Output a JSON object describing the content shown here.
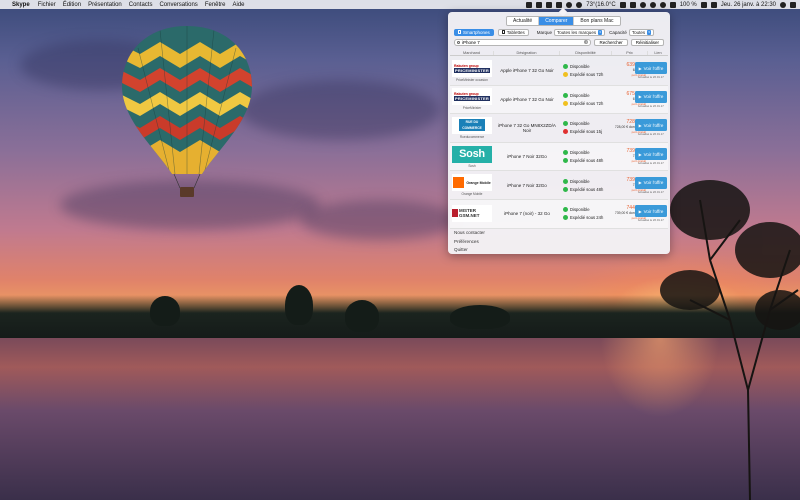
{
  "menubar": {
    "apple": "",
    "app": "Skype",
    "items": [
      "Fichier",
      "Édition",
      "Présentation",
      "Contacts",
      "Conversations",
      "Fenêtre",
      "Aide"
    ],
    "temperature": "73°(16.0°C",
    "battery": "100 %",
    "datetime": "Jeu. 26 janv. à 22:30"
  },
  "popover": {
    "tabs": [
      {
        "label": "Actualité",
        "active": false
      },
      {
        "label": "Comparer",
        "active": true
      },
      {
        "label": "Bon plans Mac",
        "active": false
      }
    ],
    "filters": {
      "smartphones": "Smartphones",
      "tablettes": "Tablettes",
      "marque_label": "Marque",
      "marque_value": "Toutes les marques",
      "capacite_label": "Capacité",
      "capacite_value": "Toutes"
    },
    "search": {
      "value": "iPhone 7",
      "rechercher": "Rechercher",
      "reinitialiser": "Réinitialiser"
    },
    "columns": [
      "Marchand",
      "Désignation",
      "Disponibilité",
      "Prix",
      "Lien"
    ],
    "rows": [
      {
        "logo": "rakuten",
        "logo_top": "Rakuten group",
        "logo_main": "PRICEMINISTER",
        "merchant": "PriceMinister occasion",
        "designation": "Apple iPhone 7 32 Go Noir",
        "dispo1": "Disponible",
        "dispo1_color": "green",
        "dispo2": "Expédié sous 72h",
        "dispo2_color": "yellow",
        "price": "639,00 €",
        "price_sub": "639,00 €",
        "price_opt": "port gratuit",
        "cta": "Voir l'offre",
        "updated": "actualisé le 26.01.17"
      },
      {
        "logo": "rakuten",
        "logo_top": "Rakuten group",
        "logo_main": "PRICEMINISTER",
        "merchant": "PriceMinister",
        "designation": "Apple iPhone 7 32 Go Noir",
        "dispo1": "Disponible",
        "dispo1_color": "green",
        "dispo2": "Expédié sous 72h",
        "dispo2_color": "yellow",
        "price": "675,55 €",
        "price_sub": "675,55 €",
        "price_opt": "port gratuit",
        "cta": "Voir l'offre",
        "updated": "actualisé le 26.01.17"
      },
      {
        "logo": "rue",
        "logo_main": "RUE DU COMMERCE",
        "merchant": "Rueducommerce",
        "designation": "iPhone 7 32 Go MN8X2ZD/A Noir",
        "dispo1": "Disponible",
        "dispo1_color": "green",
        "dispo2": "Expédié sous 15j",
        "dispo2_color": "red",
        "price": "728,00 €",
        "price_sub": "728,00 € dont 0,07 €",
        "price_opt": "port gratuit",
        "cta": "Voir l'offre",
        "updated": "actualisé le 26.01.17"
      },
      {
        "logo": "sosh",
        "logo_main": "Sosh",
        "merchant": "Sosh",
        "designation": "iPhone 7 Noir 32Go",
        "dispo1": "Disponible",
        "dispo1_color": "green",
        "dispo2": "Expédié sous 48h",
        "dispo2_color": "green",
        "price": "739,00 €",
        "price_sub": "739,00 €",
        "price_opt": "port gratuit",
        "cta": "Voir l'offre",
        "updated": "actualisé le 26.01.17"
      },
      {
        "logo": "orange",
        "logo_main": "Orange Mobile",
        "merchant": "Orange Mobile",
        "designation": "iPhone 7 Noir 32Go",
        "dispo1": "Disponible",
        "dispo1_color": "green",
        "dispo2": "Expédié sous 48h",
        "dispo2_color": "green",
        "price": "739,80 €",
        "price_sub": "739,80 €",
        "price_opt": "port gratuit",
        "cta": "Voir l'offre",
        "updated": "actualisé le 26.01.17"
      },
      {
        "logo": "ms",
        "logo_main": "MISTER GSM.NET",
        "merchant": "",
        "designation": "iPhone 7 (noir) - 32 Go",
        "dispo1": "Disponible",
        "dispo1_color": "green",
        "dispo2": "Expédié sous 24h",
        "dispo2_color": "green",
        "price": "744,99 €",
        "price_sub": "739,00 € dont 0,00 €",
        "price_opt": "port gratuit",
        "cta": "Voir l'offre",
        "updated": "actualisé le 26.01.17"
      }
    ],
    "footer": [
      "Nous contacter",
      "Préférences",
      "Quitter"
    ]
  }
}
